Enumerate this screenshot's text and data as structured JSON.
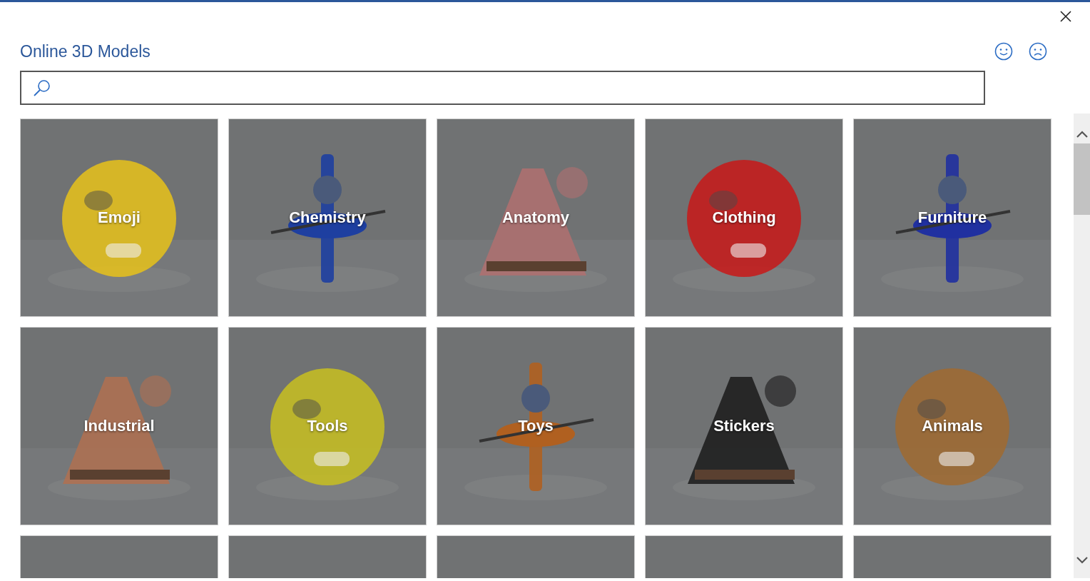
{
  "dialog": {
    "title": "Online 3D Models"
  },
  "tiles": [
    {
      "kind": "category",
      "label": "Emoji"
    },
    {
      "kind": "category",
      "label": "Chemistry"
    },
    {
      "kind": "category",
      "label": "Anatomy"
    },
    {
      "kind": "category",
      "label": "Clothing"
    },
    {
      "kind": "category",
      "label": "Furniture"
    },
    {
      "kind": "category",
      "label": "Industrial"
    },
    {
      "kind": "category",
      "label": "Tools"
    },
    {
      "kind": "category",
      "label": "Toys"
    },
    {
      "kind": "category",
      "label": "Stickers"
    },
    {
      "kind": "category",
      "label": "Animals"
    },
    {
      "kind": "picture"
    },
    {
      "kind": "picture"
    },
    {
      "kind": "picture"
    },
    {
      "kind": "picture"
    },
    {
      "kind": "picture"
    }
  ]
}
